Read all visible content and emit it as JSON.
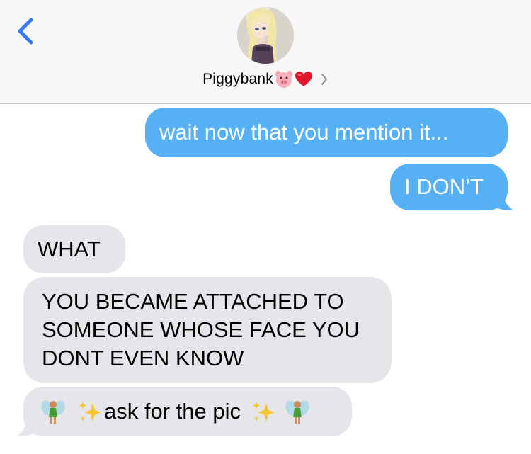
{
  "header": {
    "back_label": "back",
    "contact_name": "Piggybank",
    "contact_emojis": [
      "pig-face-icon",
      "red-heart-icon"
    ],
    "colors": {
      "header_bg": "#f7f7f7",
      "accent": "#3478f6"
    }
  },
  "messages": [
    {
      "direction": "sent",
      "text": "wait now that you mention it..."
    },
    {
      "direction": "sent",
      "text": "I DON’T"
    },
    {
      "direction": "received",
      "text": "WHAT"
    },
    {
      "direction": "received",
      "lines": [
        "YOU BECAME ATTACHED TO",
        "SOMEONE WHOSE FACE YOU",
        "DONT EVEN KNOW"
      ]
    },
    {
      "direction": "received",
      "text": "ask for the pic",
      "emojis": [
        "fairy-icon",
        "sparkles-icon",
        "sparkles-icon",
        "fairy-icon"
      ]
    }
  ],
  "colors": {
    "sent_bubble": "#57b0f4",
    "received_bubble": "#e5e5ea"
  }
}
